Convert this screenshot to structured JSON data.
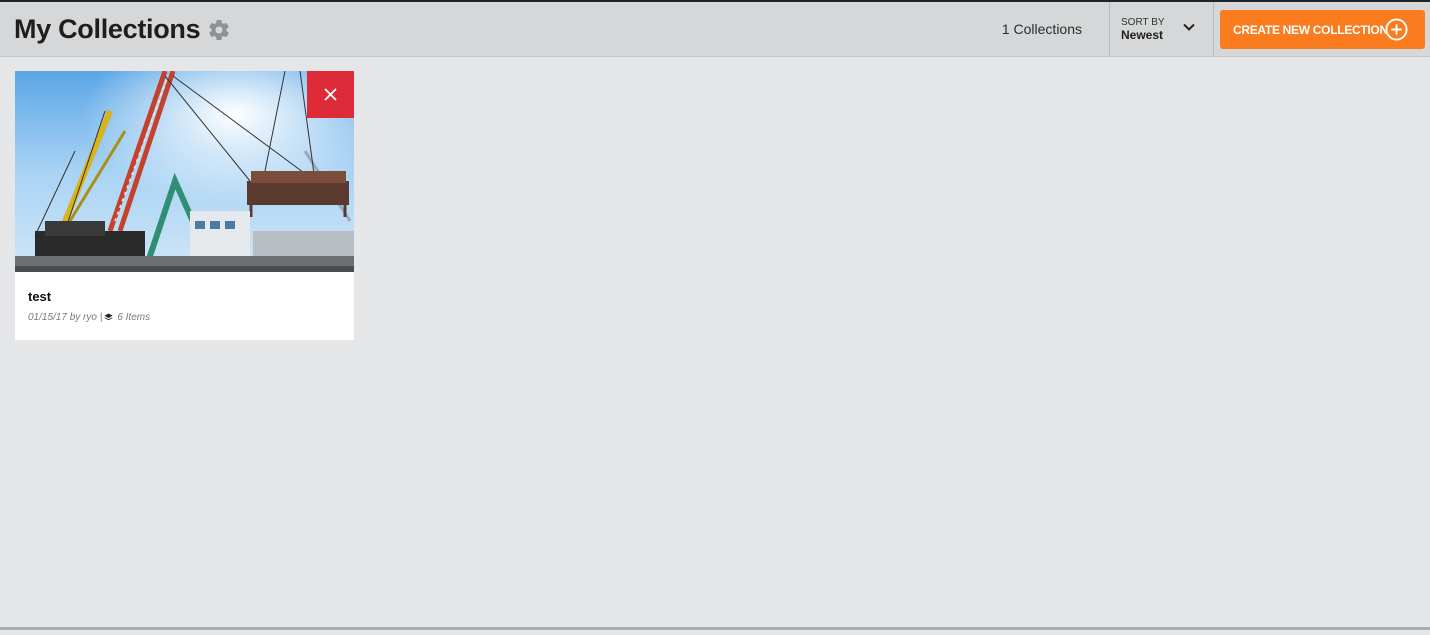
{
  "header": {
    "title": "My Collections",
    "settings_icon": "gear-icon",
    "collections_count": "1 Collections",
    "sort": {
      "label": "SORT BY",
      "value": "Newest"
    },
    "create_button": {
      "label": "CREATE NEW COLLECTION",
      "icon": "plus-circle-icon"
    }
  },
  "collections": [
    {
      "title": "test",
      "meta_date_author": "01/15/17 by ryo |",
      "meta_items": "6 Items",
      "image_subject": "construction cranes lifting steel structure",
      "delete_icon": "close-icon"
    }
  ],
  "colors": {
    "header_bg": "#d5d7d9",
    "page_bg": "#e5e6e8",
    "accent_orange": "#fb7c1e",
    "delete_red": "#de2b3a"
  }
}
